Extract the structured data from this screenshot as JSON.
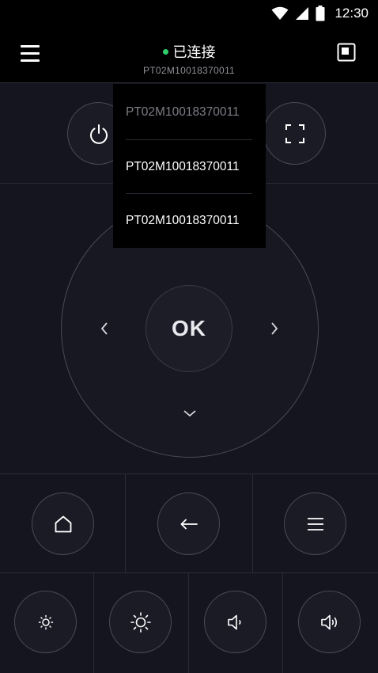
{
  "status_bar": {
    "time": "12:30"
  },
  "header": {
    "connection_status": "已连接",
    "device_id": "PT02M10018370011",
    "status_color": "#2fcf6c"
  },
  "icons": {
    "menu": "hamburger-menu-icon",
    "screen": "screen-mirror-icon",
    "power": "power-icon",
    "fullscreen": "fullscreen-icon",
    "home": "home-icon",
    "back": "back-arrow-icon",
    "options": "options-menu-icon",
    "brightness_down": "brightness-down-icon",
    "brightness_up": "brightness-up-icon",
    "volume_down": "volume-down-icon",
    "volume_up": "volume-up-icon"
  },
  "dpad": {
    "ok_label": "OK"
  },
  "dropdown": {
    "items": [
      "PT02M10018370011",
      "PT02M10018370011",
      "PT02M10018370011"
    ]
  }
}
